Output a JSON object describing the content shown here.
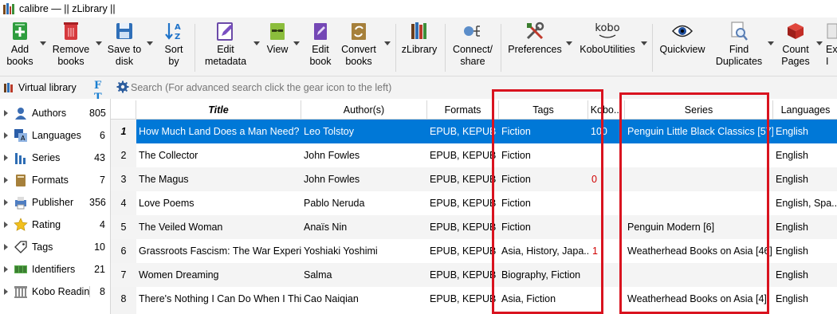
{
  "window": {
    "title": "calibre — || zLibrary ||"
  },
  "toolbar": {
    "add_books": "Add\nbooks",
    "remove_books": "Remove\nbooks",
    "save_to_disk": "Save to\ndisk",
    "sort_by": "Sort\nby",
    "edit_metadata": "Edit\nmetadata",
    "view": "View",
    "edit_book": "Edit\nbook",
    "convert_books": "Convert\nbooks",
    "zlibrary": "zLibrary",
    "connect_share": "Connect/\nshare",
    "preferences": "Preferences",
    "kobo_logo": "kobo",
    "koboutilities": "KoboUtilities",
    "quickview": "Quickview",
    "find_duplicates": "Find\nDuplicates",
    "count_pages": "Count\nPages",
    "extract_cut": "Ex\nI"
  },
  "search": {
    "virtual_library": "Virtual library",
    "placeholder": "Search (For advanced search click the gear icon to the left)",
    "ft_icon": "F T"
  },
  "tag_browser": [
    {
      "label": "Authors",
      "count": "805",
      "icon": "authors-icon"
    },
    {
      "label": "Languages",
      "count": "6",
      "icon": "languages-icon"
    },
    {
      "label": "Series",
      "count": "43",
      "icon": "series-icon"
    },
    {
      "label": "Formats",
      "count": "7",
      "icon": "formats-icon"
    },
    {
      "label": "Publisher",
      "count": "356",
      "icon": "publisher-icon"
    },
    {
      "label": "Rating",
      "count": "4",
      "icon": "rating-icon"
    },
    {
      "label": "Tags",
      "count": "10",
      "icon": "tags-icon"
    },
    {
      "label": "Identifiers",
      "count": "21",
      "icon": "identifiers-icon"
    },
    {
      "label": "Kobo Reading",
      "count": "8",
      "icon": "kobo-reading-icon"
    }
  ],
  "table": {
    "headers": {
      "title": "Title",
      "authors": "Author(s)",
      "formats": "Formats",
      "tags": "Tags",
      "kobo": "Kobo...",
      "series": "Series",
      "languages": "Languages"
    },
    "rows": [
      {
        "num": "1",
        "title": "How Much Land Does a Man Need?",
        "authors": "Leo Tolstoy",
        "formats": "EPUB, KEPUB",
        "tags": "Fiction",
        "kobo": "100",
        "series": "Penguin Little Black Classics [57]",
        "languages": "English"
      },
      {
        "num": "2",
        "title": "The Collector",
        "authors": "John Fowles",
        "formats": "EPUB, KEPUB",
        "tags": "Fiction",
        "kobo": "",
        "series": "",
        "languages": "English"
      },
      {
        "num": "3",
        "title": "The Magus",
        "authors": "John Fowles",
        "formats": "EPUB, KEPUB",
        "tags": "Fiction",
        "kobo": "0",
        "series": "",
        "languages": "English"
      },
      {
        "num": "4",
        "title": "Love Poems",
        "authors": "Pablo Neruda",
        "formats": "EPUB, KEPUB",
        "tags": "Fiction",
        "kobo": "",
        "series": "",
        "languages": "English, Spa..."
      },
      {
        "num": "5",
        "title": "The Veiled Woman",
        "authors": "Anaïs Nin",
        "formats": "EPUB, KEPUB",
        "tags": "Fiction",
        "kobo": "",
        "series": "Penguin Modern [6]",
        "languages": "English"
      },
      {
        "num": "6",
        "title": "Grassroots Fascism: The War Experie...",
        "authors": "Yoshiaki Yoshimi",
        "formats": "EPUB, KEPUB",
        "tags": "Asia, History, Japa...",
        "kobo": "1",
        "series": "Weatherhead Books on Asia [46]",
        "languages": "English"
      },
      {
        "num": "7",
        "title": "Women Dreaming",
        "authors": "Salma",
        "formats": "EPUB, KEPUB",
        "tags": "Biography, Fiction",
        "kobo": "",
        "series": "",
        "languages": "English"
      },
      {
        "num": "8",
        "title": "There's Nothing I Can Do When I Thi...",
        "authors": "Cao Naiqian",
        "formats": "EPUB, KEPUB",
        "tags": "Asia, Fiction",
        "kobo": "",
        "series": "Weatherhead Books on Asia [4]",
        "languages": "English"
      }
    ],
    "selected_row": "1"
  },
  "colors": {
    "selection": "#0078d7",
    "highlight": "#d9131f",
    "kobo_progress": "#d00000"
  }
}
